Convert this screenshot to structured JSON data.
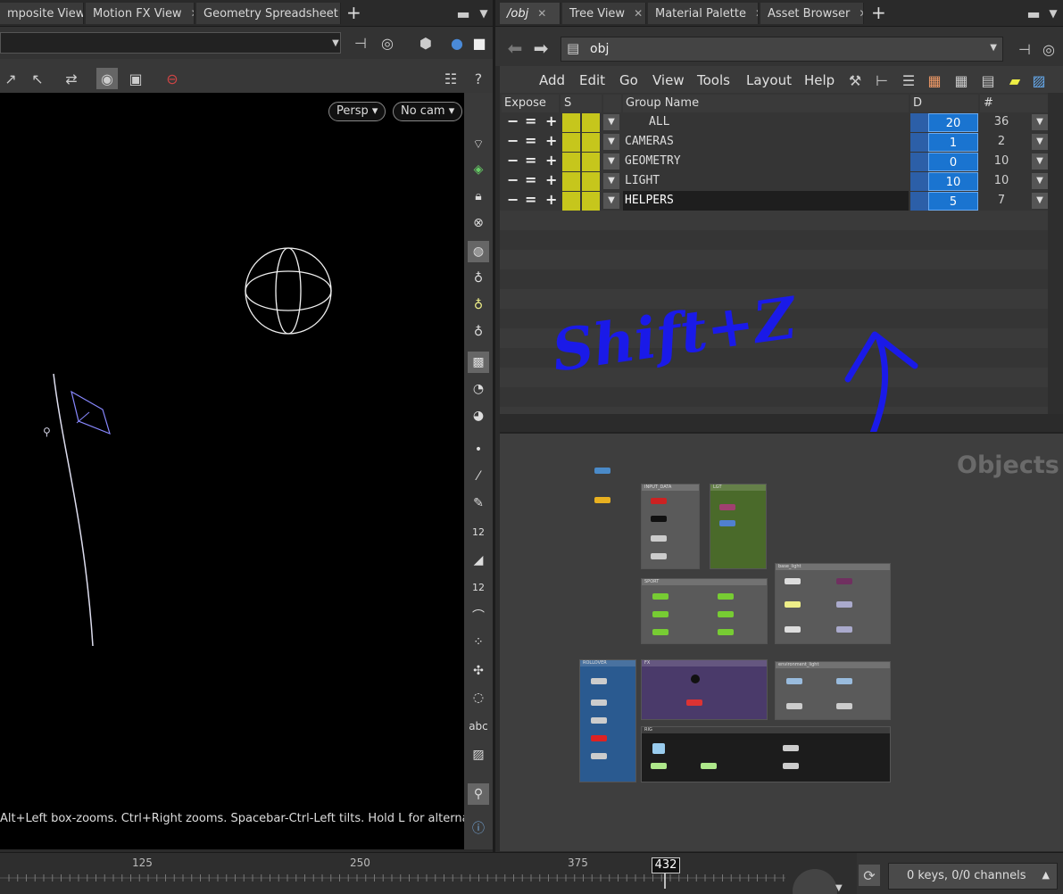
{
  "left_pane": {
    "tabs": [
      {
        "label": "mposite View"
      },
      {
        "label": "Motion FX View"
      },
      {
        "label": "Geometry Spreadsheet"
      }
    ],
    "viewport": {
      "persp_label": "Persp",
      "cam_label": "No cam",
      "status_hint": "Alt+Left box-zooms. Ctrl+Right zooms. Spacebar-Ctrl-Left tilts. Hold L for alternate"
    },
    "shelf_labels": {
      "twelve_a": "12",
      "twelve_b": "12",
      "abc": "abc"
    }
  },
  "right_pane": {
    "tabs": [
      {
        "label": "/obj"
      },
      {
        "label": "Tree View"
      },
      {
        "label": "Material Palette"
      },
      {
        "label": "Asset Browser"
      }
    ],
    "path": "obj",
    "menu": [
      "Add",
      "Edit",
      "Go",
      "View",
      "Tools",
      "Layout",
      "Help"
    ],
    "columns": {
      "expose": "Expose",
      "s": "S",
      "group_name": "Group Name",
      "d": "D",
      "count": "#"
    },
    "groups": [
      {
        "minus": "−",
        "eq": "=",
        "plus": "+",
        "name": "ALL",
        "d": "20",
        "count": "36"
      },
      {
        "minus": "−",
        "eq": "=",
        "plus": "+",
        "name": "CAMERAS",
        "d": "1",
        "count": "2"
      },
      {
        "minus": "−",
        "eq": "=",
        "plus": "+",
        "name": "GEOMETRY",
        "d": "0",
        "count": "10"
      },
      {
        "minus": "−",
        "eq": "=",
        "plus": "+",
        "name": "LIGHT",
        "d": "10",
        "count": "10"
      },
      {
        "minus": "−",
        "eq": "=",
        "plus": "+",
        "name": "HELPERS",
        "d": "5",
        "count": "7"
      }
    ],
    "annotation": "Shift+Z",
    "network_label": "Objects",
    "net_boxes": {
      "input_data": "INPUT_DATA",
      "lgt": "LGT",
      "sport": "SPORT",
      "base_light": "base_light",
      "rollover": "ROLLOVER",
      "fx": "FX",
      "environment_light": "environment_light",
      "rig": "RIG"
    }
  },
  "timeline": {
    "ticks": [
      "125",
      "250",
      "375"
    ],
    "current_frame": "432",
    "keys_status": "0 keys, 0/0 channels"
  },
  "colors": {
    "accent_blue": "#1a74d0",
    "yellow": "#c6c61c",
    "ink_blue": "#1a1ae8"
  }
}
